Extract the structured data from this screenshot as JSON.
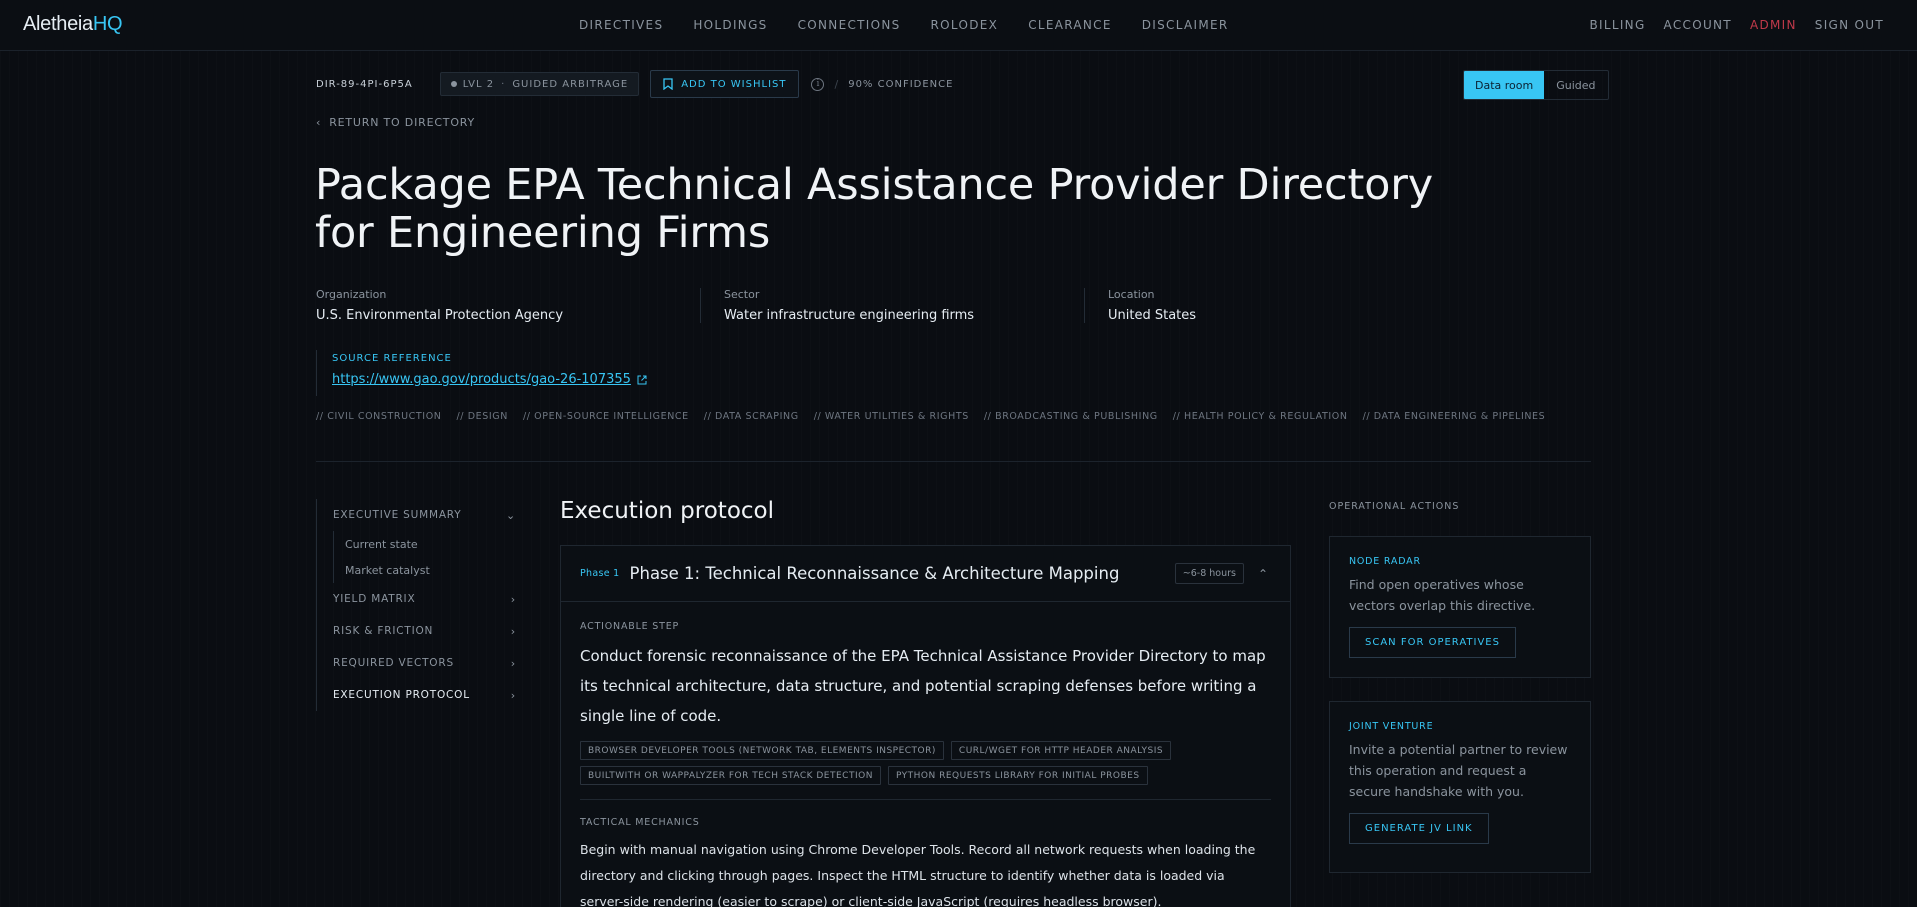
{
  "brand": {
    "name": "Aletheia",
    "suffix": "HQ"
  },
  "nav": {
    "center": [
      "DIRECTIVES",
      "HOLDINGS",
      "CONNECTIONS",
      "ROLODEX",
      "CLEARANCE",
      "DISCLAIMER"
    ],
    "right": [
      "BILLING",
      "ACCOUNT",
      "ADMIN",
      "SIGN OUT"
    ]
  },
  "meta": {
    "directive_id": "DIR-89-4PI-6P5A",
    "level": "LVL 2",
    "mode": "GUIDED ARBITRAGE",
    "wishlist_label": "ADD TO WISHLIST",
    "separator": "/",
    "confidence": "90% CONFIDENCE"
  },
  "view_toggle": {
    "options": [
      "Data room",
      "Guided"
    ],
    "active": "Data room"
  },
  "back_link": "RETURN TO DIRECTORY",
  "title": "Package EPA Technical Assistance Provider Directory for Engineering Firms",
  "facts": [
    {
      "label": "Organization",
      "value": "U.S. Environmental Protection Agency"
    },
    {
      "label": "Sector",
      "value": "Water infrastructure engineering firms"
    },
    {
      "label": "Location",
      "value": "United States"
    }
  ],
  "source": {
    "label": "SOURCE REFERENCE",
    "url": "https://www.gao.gov/products/gao-26-107355"
  },
  "tags": [
    "// CIVIL CONSTRUCTION",
    "// DESIGN",
    "// OPEN-SOURCE INTELLIGENCE",
    "// DATA SCRAPING",
    "// WATER UTILITIES & RIGHTS",
    "// BROADCASTING & PUBLISHING",
    "// HEALTH POLICY & REGULATION",
    "// DATA ENGINEERING & PIPELINES"
  ],
  "sidebar": {
    "executive_summary": "EXECUTIVE SUMMARY",
    "sub_items": [
      "Current state",
      "Market catalyst"
    ],
    "items": [
      "YIELD MATRIX",
      "RISK & FRICTION",
      "REQUIRED VECTORS",
      "EXECUTION PROTOCOL"
    ]
  },
  "main": {
    "heading": "Execution protocol",
    "phase": {
      "number": "Phase 1",
      "title": "Phase 1: Technical Reconnaissance & Architecture Mapping",
      "duration": "~6-8 hours",
      "step_label": "ACTIONABLE STEP",
      "step_text": "Conduct forensic reconnaissance of the EPA Technical Assistance Provider Directory to map its technical architecture, data structure, and potential scraping defenses before writing a single line of code.",
      "tools": [
        "BROWSER DEVELOPER TOOLS (NETWORK TAB, ELEMENTS INSPECTOR)",
        "CURL/WGET FOR HTTP HEADER ANALYSIS",
        "BUILTWITH OR WAPPALYZER FOR TECH STACK DETECTION",
        "PYTHON REQUESTS LIBRARY FOR INITIAL PROBES"
      ],
      "mechanics_label": "TACTICAL MECHANICS",
      "mechanics_text": "Begin with manual navigation using Chrome Developer Tools. Record all network requests when loading the directory and clicking through pages. Inspect the HTML structure to identify whether data is loaded via server-side rendering (easier to scrape) or client-side JavaScript (requires headless browser)."
    }
  },
  "operations": {
    "label": "OPERATIONAL ACTIONS",
    "cards": [
      {
        "title": "NODE RADAR",
        "desc": "Find open operatives whose vectors overlap this directive.",
        "button": "SCAN FOR OPERATIVES"
      },
      {
        "title": "JOINT VENTURE",
        "desc": "Invite a potential partner to review this operation and request a secure handshake with you.",
        "button": "GENERATE JV LINK"
      }
    ]
  },
  "colors": {
    "accent": "#38c6f4",
    "admin": "#c0394a",
    "background": "#0a0d12"
  }
}
